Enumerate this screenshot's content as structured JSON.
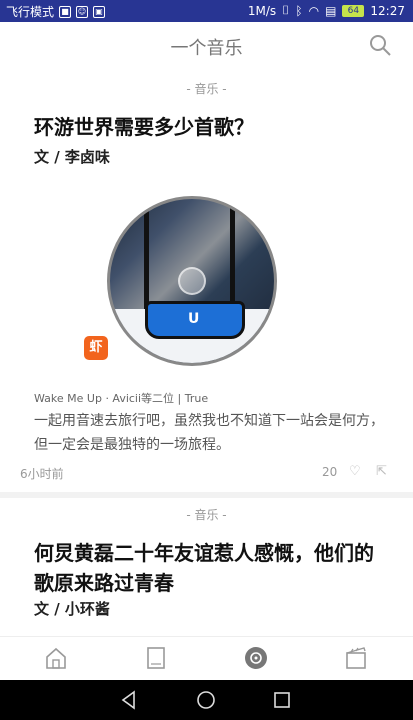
{
  "status_bar": {
    "left_text": "飞行模式",
    "speed": "1M/s",
    "battery": "64",
    "time": "12:27"
  },
  "header": {
    "title": "一个音乐"
  },
  "cards": [
    {
      "tag": "- 音乐 -",
      "title": "环游世界需要多少首歌？",
      "author": "文 / 李卤味",
      "song_info": "Wake Me Up · Avicii等二位 | True",
      "description": "一起用音速去旅行吧，虽然我也不知道下一站会是何方，但一定会是最独特的一场旅程。",
      "time_ago": "6小时前",
      "likes": "20",
      "source_badge": "虾"
    },
    {
      "tag": "- 音乐 -",
      "title": "何炅黄磊二十年友谊惹人感慨，他们的歌原来路过青春",
      "author": "文 / 小环酱"
    }
  ],
  "bottom_nav": [
    "home-icon",
    "reading-icon",
    "music-icon",
    "movie-icon"
  ],
  "colors": {
    "status_bar": "#283593",
    "brand_badge": "#f2641d"
  }
}
